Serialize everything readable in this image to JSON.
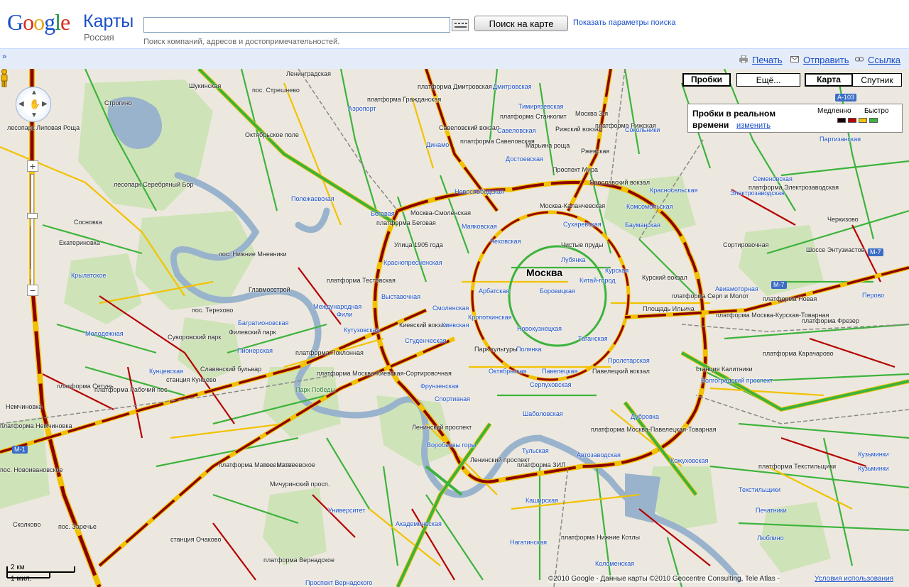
{
  "header": {
    "logo_text": "Google",
    "product_name": "Карты",
    "region": "Россия",
    "search_value": "",
    "search_button": "Поиск на карте",
    "search_params_link": "Показать параметры поиска",
    "search_hint": "Поиск компаний, адресов и достопримечательностей."
  },
  "toolbar": {
    "collapse": "»",
    "print": "Печать",
    "send": "Отправить",
    "link": "Ссылка"
  },
  "map_controls": {
    "zoom_in": "+",
    "zoom_out": "−",
    "traffic_button": "Пробки",
    "more_button": "Ещё...",
    "map_button": "Карта",
    "satellite_button": "Спутник",
    "active_type": "Карта"
  },
  "traffic_legend": {
    "title": "Пробки в реальном времени",
    "change_link": "изменить",
    "slow": "Медленно",
    "fast": "Быстро",
    "colors": [
      "#1a0000",
      "#b50000",
      "#f2c200",
      "#3eb53e"
    ]
  },
  "map": {
    "city_label": "Москва",
    "labels": [
      "Ленинградская",
      "Шукинская",
      "пос. Стрешнево",
      "платформа Дмитровская",
      "Дмитровская",
      "Строгино",
      "платформа Гражданская",
      "Аэропорт",
      "Тимирязевская",
      "Москва 3-я",
      "лесопарк Липовая Роща",
      "Октябрьское поле",
      "Савеловский вокзал",
      "платформа Станколит",
      "Савеловская",
      "Рижский вокзал",
      "платформа Рижская",
      "Сокольники",
      "Партизанская",
      "Динамо",
      "платформа Савеловская",
      "Марьина роща",
      "Ржевская",
      "Достоевская",
      "Проспект Мира",
      "Ярославский вокзал",
      "Красносельская",
      "Семеновская",
      "лесопарк Серебряный Бор",
      "Полежаевская",
      "Новослободская",
      "платформа Электрозаводская",
      "Электрозаводская",
      "Сосновка",
      "Беговая",
      "Москва-Смоленская",
      "Москва-Каланчевская",
      "Комсомольская",
      "платформа Беговая",
      "Маяковская",
      "Сухаревская",
      "Бауманская",
      "Черкизово",
      "Екатериновка",
      "пос. Нижние Мневники",
      "Улица 1905 года",
      "Чеховская",
      "Чистые пруды",
      "Сортировочная",
      "Шоссе Энтузиастов",
      "Крылатское",
      "Краснопресненская",
      "Лубянка",
      "Курская",
      "Курский вокзал",
      "Авиамоторная",
      "Главмосстрой",
      "платформа Тестовская",
      "Выставочная",
      "Арбатская",
      "Боровицкая",
      "Китай-город",
      "платформа Серп и Молот",
      "Перово",
      "пос. Терехово",
      "Международная",
      "Смоленская",
      "Кропоткинская",
      "Площадь Ильича",
      "платформа Новая",
      "Филевский парк",
      "Фили",
      "Багратионовская",
      "Киевский вокзал",
      "Киевская",
      "Новокузнецкая",
      "Таганская",
      "платформа Москва-Курская-Товарная",
      "Молодежная",
      "Кутузовская",
      "Студенческая",
      "Полянка",
      "платформа Фрезер",
      "Суворовский парк",
      "Пионерская",
      "платформа Поклонная",
      "Парк культуры",
      "Октябрьская",
      "Павелецкая",
      "Павелецкий вокзал",
      "Пролетарская",
      "Кунцевская",
      "Славянский бульвар",
      "платформа Москва-Киевская-Сортировочная",
      "станция Калитники",
      "Волгоградский проспект",
      "станция Кунцево",
      "Фрунзенская",
      "Серпуховская",
      "платформа Карачарово",
      "платформа Сетунь",
      "платформа Рабочий пос.",
      "Парк Победы",
      "Спортивная",
      "Шаболовская",
      "Дубровка",
      "Немчиновка",
      "платформа Немчиновка",
      "Воробьевы горы",
      "Ленинский проспект",
      "Тульская",
      "платформа Москва-Павелецкая-Товарная",
      "Автозаводская",
      "платформа Текстильщики",
      "Кузьминки",
      "пос. Новоивановское",
      "платформа Матвеевская",
      "пос. Матвеевское",
      "платформа ЗИЛ",
      "Кожуховская",
      "Нагатинская",
      "Каширская",
      "Коломенская",
      "Университет",
      "Академическая",
      "платформа Нижние Котлы",
      "Печатники",
      "Люблино",
      "Сколково",
      "пос. Заречье",
      "станция Очаково",
      "платформа Вернадское",
      "Проспект Вернадского",
      "Ленинский проспект",
      "Мичуринский просп.",
      "Текстильщики",
      "Кузьминки"
    ],
    "road_shields": [
      "А-103",
      "М-7",
      "М-7",
      "М-1"
    ]
  },
  "scale": {
    "km": "2 км",
    "mi": "1 мил."
  },
  "footer": {
    "copyright": "©2010 Google - Данные карты ©2010 Geocentre Consulting, Tele Atlas -",
    "terms": "Условия использования"
  }
}
